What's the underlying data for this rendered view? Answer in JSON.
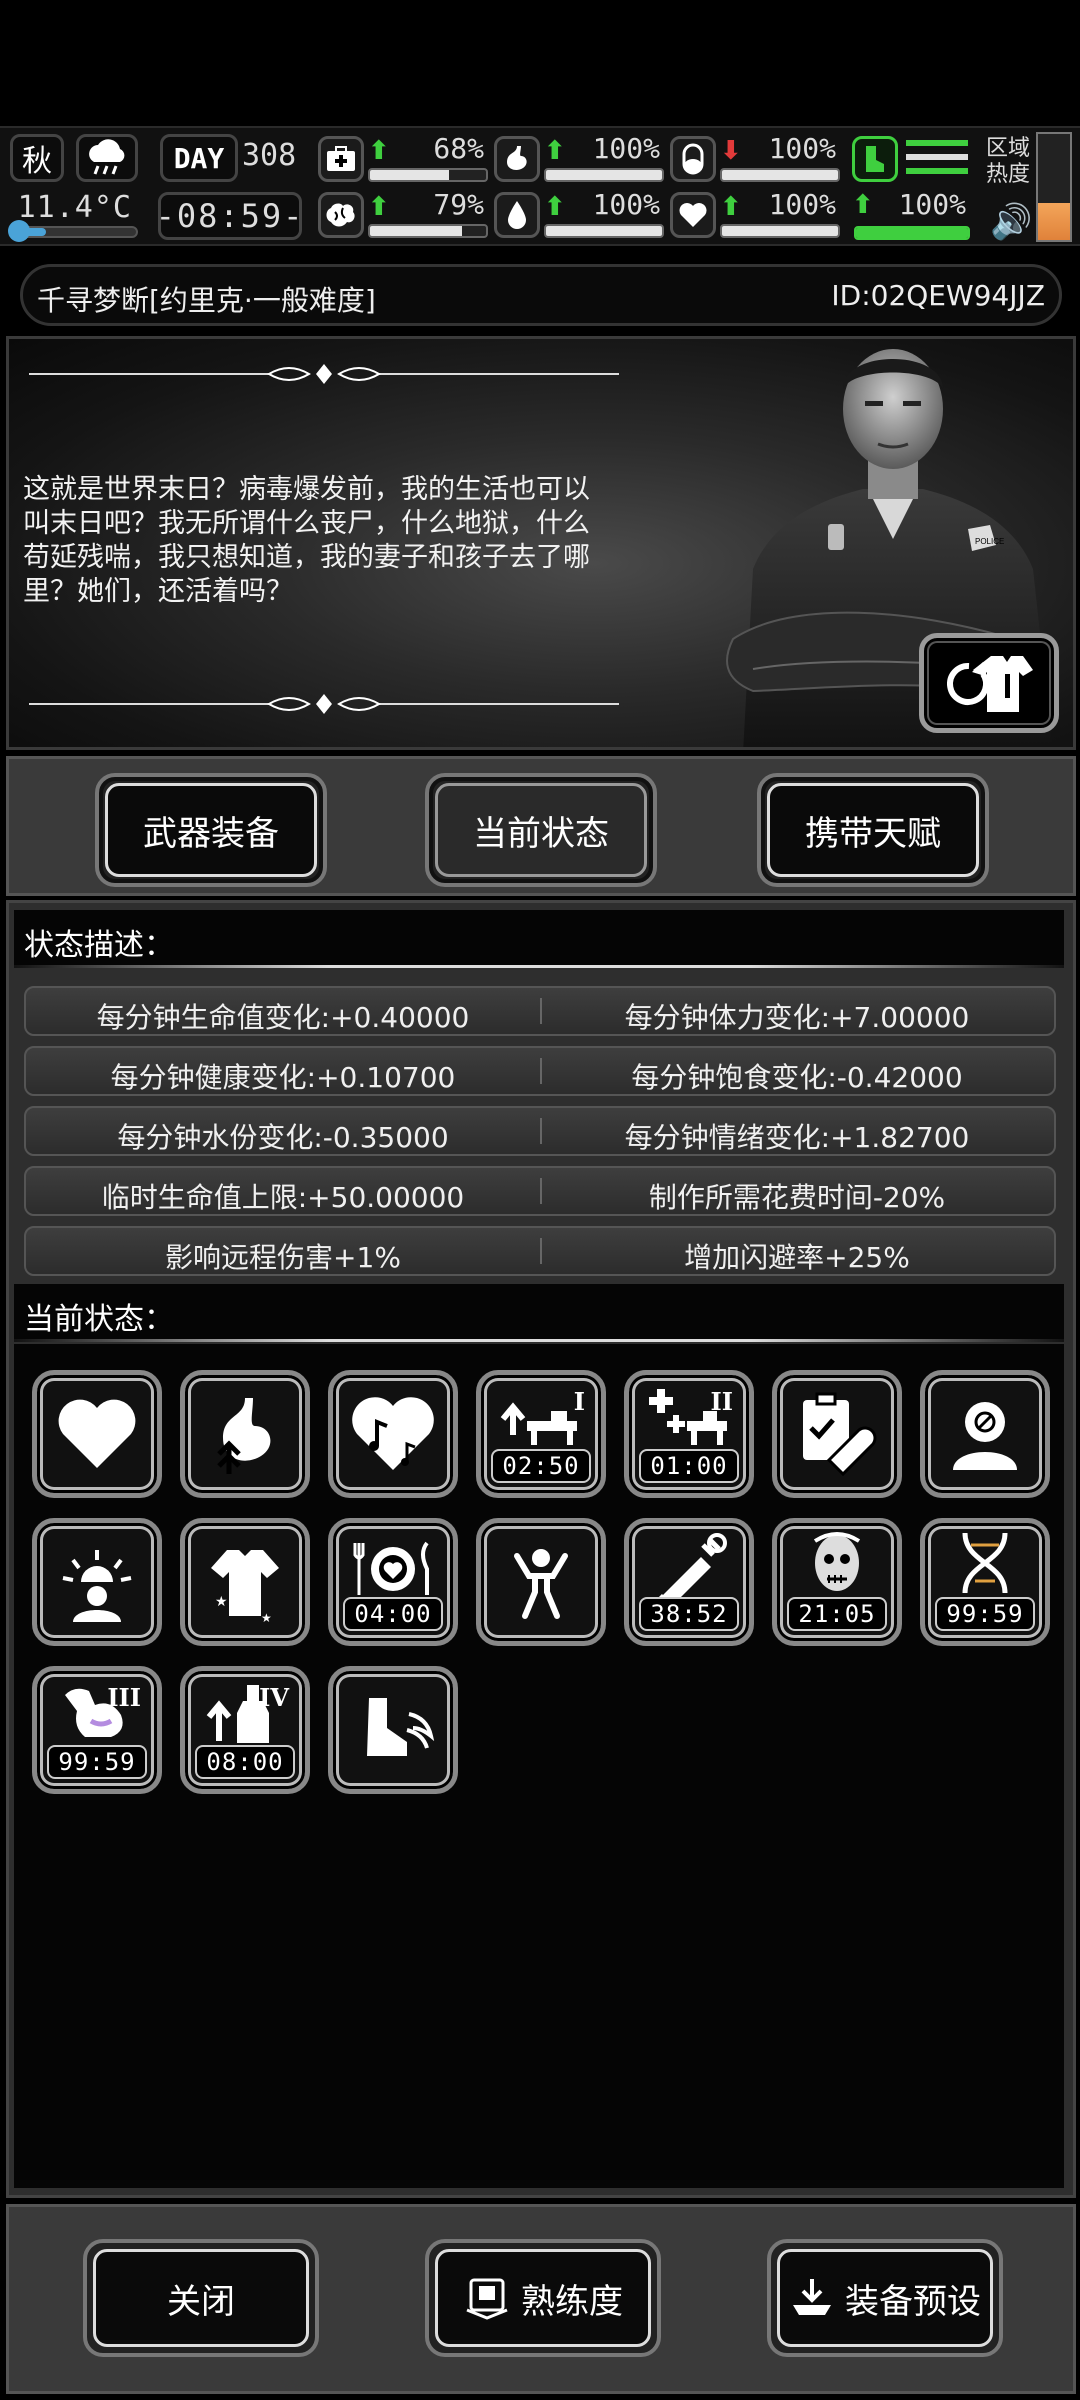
{
  "hud": {
    "season": "秋",
    "temperature": "11.4°C",
    "temperature_level": 0.25,
    "day_tag": "DAY",
    "day_number": "308",
    "clock": "-08:59-",
    "stats_row1": [
      {
        "icon": "medkit-icon",
        "trend": "up",
        "value": "68%",
        "level": 0.68
      },
      {
        "icon": "stomach-icon",
        "trend": "up",
        "value": "100%",
        "level": 1.0
      },
      {
        "icon": "pill-capsule-icon",
        "trend": "down",
        "value": "100%",
        "level": 1.0
      }
    ],
    "stats_row2": [
      {
        "icon": "brain-icon",
        "trend": "up",
        "value": "79%",
        "level": 0.79
      },
      {
        "icon": "water-drop-icon",
        "trend": "up",
        "value": "100%",
        "level": 1.0
      },
      {
        "icon": "heart-icon",
        "trend": "up",
        "value": "100%",
        "level": 1.0
      }
    ],
    "stamina": {
      "icon": "boot-icon",
      "trend": "up",
      "value": "100%",
      "level": 1.0
    },
    "zone_label_1": "区域",
    "zone_label_2": "热度",
    "zone_heat_level": 0.35,
    "colors": {
      "up": "#3fcf3f",
      "down": "#e23a3a",
      "stamina": "#3fcf3f",
      "cold": "#4aa3d8",
      "heat": "#e0823a"
    }
  },
  "title_bar": {
    "name": "千寻梦断[约里克·一般难度]",
    "id": "ID:02QEW94JJZ"
  },
  "story": {
    "text": "这就是世界末日？病毒爆发前，我的生活也可以叫末日吧？我无所谓什么丧尸，什么地狱，什么苟延残喘，我只想知道，我的妻子和孩子去了哪里？她们，还活着吗？",
    "badge_text": "POLICE"
  },
  "tabs": [
    {
      "label": "武器装备",
      "active": false
    },
    {
      "label": "当前状态",
      "active": true
    },
    {
      "label": "携带天赋",
      "active": false
    }
  ],
  "status_desc": {
    "heading": "状态描述：",
    "rows": [
      [
        "每分钟生命值变化:+0.40000",
        "每分钟体力变化:+7.00000"
      ],
      [
        "每分钟健康变化:+0.10700",
        "每分钟饱食变化:-0.42000"
      ],
      [
        "每分钟水份变化:-0.35000",
        "每分钟情绪变化:+1.82700"
      ],
      [
        "临时生命值上限:+50.00000",
        "制作所需花费时间-20%"
      ],
      [
        "影响远程伤害+1%",
        "增加闪避率+25%"
      ]
    ]
  },
  "current_status": {
    "heading": "当前状态：",
    "effects": [
      {
        "icon": "heart-icon",
        "timer": "",
        "level": ""
      },
      {
        "icon": "stomach-boost-icon",
        "timer": "",
        "level": ""
      },
      {
        "icon": "music-heart-icon",
        "timer": "",
        "level": ""
      },
      {
        "icon": "workbench-boost-icon",
        "timer": "02:50",
        "level": "I"
      },
      {
        "icon": "medical-workbench-icon",
        "timer": "01:00",
        "level": "II"
      },
      {
        "icon": "prescription-pill-icon",
        "timer": "",
        "level": ""
      },
      {
        "icon": "sick-person-icon",
        "timer": "",
        "level": ""
      },
      {
        "icon": "alarm-person-icon",
        "timer": "",
        "level": ""
      },
      {
        "icon": "shirt-icon",
        "timer": "",
        "level": ""
      },
      {
        "icon": "meal-plate-icon",
        "timer": "04:00",
        "level": ""
      },
      {
        "icon": "strong-person-icon",
        "timer": "",
        "level": ""
      },
      {
        "icon": "syringe-icon",
        "timer": "38:52",
        "level": ""
      },
      {
        "icon": "zombie-face-icon",
        "timer": "21:05",
        "level": ""
      },
      {
        "icon": "dna-icon",
        "timer": "99:59",
        "level": ""
      },
      {
        "icon": "muscle-arm-icon",
        "timer": "99:59",
        "level": "III"
      },
      {
        "icon": "bottle-boost-icon",
        "timer": "08:00",
        "level": "IV"
      },
      {
        "icon": "winged-boot-icon",
        "timer": "",
        "level": ""
      }
    ]
  },
  "bottom": {
    "close_label": "关闭",
    "proficiency_label": "熟练度",
    "preset_label": "装备预设"
  }
}
